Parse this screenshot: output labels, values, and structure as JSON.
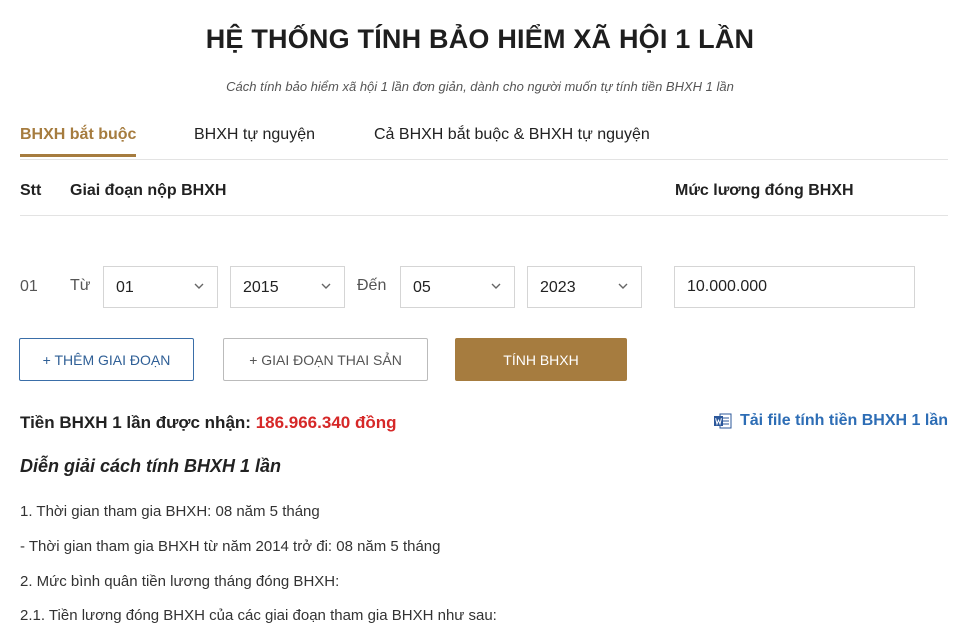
{
  "header": {
    "title": "HỆ THỐNG TÍNH BẢO HIỂM XÃ HỘI 1 LẦN",
    "subtitle": "Cách tính bảo hiểm xã hội 1 lần đơn giản, dành cho người muốn tự tính tiền BHXH 1 lần"
  },
  "tabs": [
    {
      "label": "BHXH bắt buộc",
      "active": true
    },
    {
      "label": "BHXH tự nguyện",
      "active": false
    },
    {
      "label": "Cả BHXH bắt buộc & BHXH tự nguyện",
      "active": false
    }
  ],
  "table_header": {
    "stt": "Stt",
    "period": "Giai đoạn nộp BHXH",
    "salary": "Mức lương đóng BHXH"
  },
  "period_row": {
    "number": "01",
    "from_label": "Từ",
    "from_month": "01",
    "from_year": "2015",
    "to_label": "Đến",
    "to_month": "05",
    "to_year": "2023",
    "salary": "10.000.000"
  },
  "buttons": {
    "add_period": "+ THÊM GIAI ĐOẠN",
    "maternity_period": "+ GIAI ĐOẠN THAI SẢN",
    "calculate": "TÍNH BHXH"
  },
  "result": {
    "label": "Tiền BHXH 1 lần được nhận:",
    "amount": "186.966.340 đồng",
    "download": "Tải file tính tiền BHXH 1 lần"
  },
  "explanation": {
    "title": "Diễn giải cách tính BHXH 1 lần",
    "lines": [
      "1. Thời gian tham gia BHXH: 08 năm 5 tháng",
      "- Thời gian tham gia BHXH từ năm 2014 trở đi: 08 năm 5 tháng",
      "2. Mức bình quân tiền lương tháng đóng BHXH:",
      "2.1. Tiền lương đóng BHXH của các giai đoạn tham gia BHXH như sau:"
    ]
  },
  "colors": {
    "accent": "#a67c3f",
    "link": "#2d6db5",
    "amount": "#d62828"
  }
}
